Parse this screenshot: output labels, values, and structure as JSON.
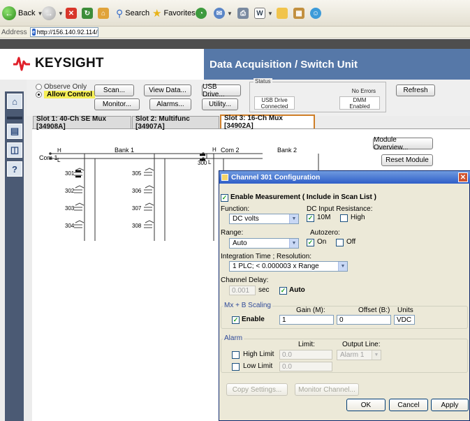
{
  "browser": {
    "back_label": "Back",
    "search_label": "Search",
    "favorites_label": "Favorites",
    "address_label": "Address",
    "url": "http://156.140.92.114/"
  },
  "header": {
    "brand": "KEYSIGHT",
    "title": "Data Acquisition / Switch Unit"
  },
  "control": {
    "observe_only": "Observe Only",
    "allow_control": "Allow Control",
    "buttons": {
      "scan": "Scan...",
      "view_data": "View Data...",
      "usb_drive": "USB Drive...",
      "monitor": "Monitor...",
      "alarms": "Alarms...",
      "utility": "Utility...",
      "refresh": "Refresh"
    },
    "status": {
      "legend": "Status",
      "errors": "No Errors",
      "usb_line1": "USB Drive",
      "usb_line2": "Connected",
      "dmm_line1": "DMM",
      "dmm_line2": "Enabled"
    }
  },
  "tabs": [
    {
      "label": "Slot 1: 40-Ch SE Mux [34908A]"
    },
    {
      "label": "Slot 2: Multifunc [34907A]"
    },
    {
      "label": "Slot 3: 16-Ch Mux [34902A]"
    }
  ],
  "schematic": {
    "com1": "Com 1",
    "h": "H",
    "l": "L",
    "bank1": "Bank 1",
    "com2": "Com 2",
    "bank2": "Bank 2",
    "ch300": "300",
    "channels": [
      "301",
      "302",
      "303",
      "304",
      "305",
      "306",
      "307",
      "308"
    ]
  },
  "module_buttons": {
    "overview": "Module Overview...",
    "reset": "Reset Module"
  },
  "dialog": {
    "title": "Channel 301 Configuration",
    "enable_measurement": "Enable Measurement ( Include in Scan List )",
    "function_label": "Function:",
    "function_value": "DC volts",
    "dc_input_label": "DC Input Resistance:",
    "dc_10m": "10M",
    "dc_high": "High",
    "range_label": "Range:",
    "range_value": "Auto",
    "autozero_label": "Autozero:",
    "az_on": "On",
    "az_off": "Off",
    "integration_label": "Integration Time ; Resolution:",
    "integration_value": "1   PLC; < 0.000003 x Range",
    "channel_delay_label": "Channel Delay:",
    "delay_value": "0.001",
    "delay_unit": "sec",
    "delay_auto": "Auto",
    "scaling": {
      "legend": "Mx + B Scaling",
      "gain_label": "Gain (M):",
      "offset_label": "Offset (B:)",
      "units_label": "Units",
      "enable": "Enable",
      "gain_value": "1",
      "offset_value": "0",
      "units_value": "VDC"
    },
    "alarm": {
      "legend": "Alarm",
      "limit_label": "Limit:",
      "output_label": "Output Line:",
      "high_limit": "High Limit",
      "high_value": "0.0",
      "output_value": "Alarm 1",
      "low_limit": "Low Limit",
      "low_value": "0.0"
    },
    "buttons": {
      "copy": "Copy Settings...",
      "monitor": "Monitor Channel...",
      "ok": "OK",
      "cancel": "Cancel",
      "apply": "Apply"
    }
  }
}
